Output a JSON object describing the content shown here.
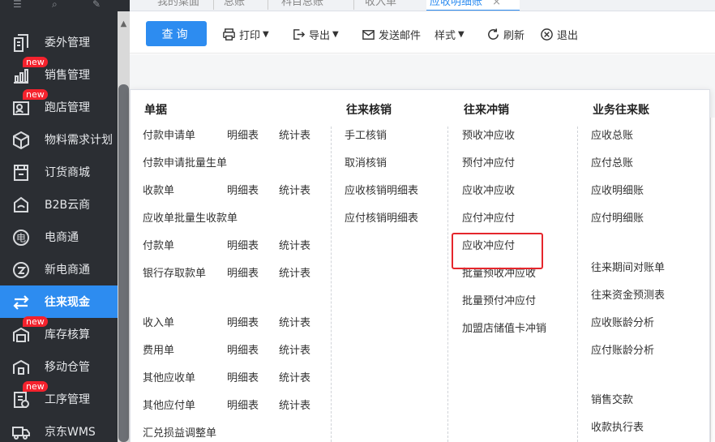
{
  "sidebar": {
    "items": [
      {
        "label": "委外管理",
        "icon": "outsource-icon",
        "badge": ""
      },
      {
        "label": "销售管理",
        "icon": "sales-chart-icon",
        "badge": "new"
      },
      {
        "label": "跑店管理",
        "icon": "store-visit-icon",
        "badge": "new"
      },
      {
        "label": "物料需求计划",
        "icon": "box-icon",
        "badge": ""
      },
      {
        "label": "订货商城",
        "icon": "shop-icon",
        "badge": ""
      },
      {
        "label": "B2B云商",
        "icon": "b2b-icon",
        "badge": ""
      },
      {
        "label": "电商通",
        "icon": "ecommerce-icon",
        "badge": ""
      },
      {
        "label": "新电商通",
        "icon": "new-ecommerce-icon",
        "badge": ""
      },
      {
        "label": "往来现金",
        "icon": "exchange-icon",
        "badge": ""
      },
      {
        "label": "库存核算",
        "icon": "inventory-icon",
        "badge": "new"
      },
      {
        "label": "移动仓管",
        "icon": "mobile-warehouse-icon",
        "badge": ""
      },
      {
        "label": "工序管理",
        "icon": "process-icon",
        "badge": "new"
      },
      {
        "label": "京东WMS",
        "icon": "truck-icon",
        "badge": ""
      }
    ],
    "active_index": 8,
    "active_color": "#2d8cf0",
    "badge_color": "#f5222d"
  },
  "tabs": [
    {
      "label": "我的桌面"
    },
    {
      "label": "总账"
    },
    {
      "label": "科目总账"
    },
    {
      "label": "收入单"
    },
    {
      "label": "应收明细账",
      "close": "×"
    }
  ],
  "toolbar": {
    "query": "查询",
    "print": "打印",
    "export": "导出",
    "send_mail": "发送邮件",
    "style": "样式",
    "refresh": "刷新",
    "exit": "退出"
  },
  "menu": {
    "columns": [
      {
        "title": "单据"
      },
      {
        "title": "往来核销"
      },
      {
        "title": "往来冲销"
      },
      {
        "title": "业务往来账"
      }
    ],
    "docs": [
      {
        "name": "付款申请单",
        "detail": "明细表",
        "stats": "统计表"
      },
      {
        "name": "付款申请批量生单",
        "detail": "",
        "stats": ""
      },
      {
        "name": "收款单",
        "detail": "明细表",
        "stats": "统计表"
      },
      {
        "name": "应收单批量生收款单",
        "detail": "",
        "stats": ""
      },
      {
        "name": "付款单",
        "detail": "明细表",
        "stats": "统计表"
      },
      {
        "name": "银行存取款单",
        "detail": "明细表",
        "stats": "统计表"
      },
      {
        "name": "收入单",
        "detail": "明细表",
        "stats": "统计表"
      },
      {
        "name": "费用单",
        "detail": "明细表",
        "stats": "统计表"
      },
      {
        "name": "其他应收单",
        "detail": "明细表",
        "stats": "统计表"
      },
      {
        "name": "其他应付单",
        "detail": "明细表",
        "stats": "统计表"
      },
      {
        "name": "汇兑损益调整单",
        "detail": "",
        "stats": ""
      }
    ],
    "verify": [
      "手工核销",
      "取消核销",
      "应收核销明细表",
      "应付核销明细表"
    ],
    "offset": [
      "预收冲应收",
      "预付冲应付",
      "应收冲应收",
      "应付冲应付",
      "应收冲应付",
      "批量预收冲应收",
      "批量预付冲应付",
      "加盟店储值卡冲销"
    ],
    "ledger": [
      "应收总账",
      "应付总账",
      "应收明细账",
      "应付明细账",
      "往来期间对账单",
      "往来资金预测表",
      "应收账龄分析",
      "应付账龄分析",
      "销售交款",
      "收款执行表"
    ],
    "highlighted_item": "应收冲应付",
    "highlight_color": "#e5262c"
  }
}
